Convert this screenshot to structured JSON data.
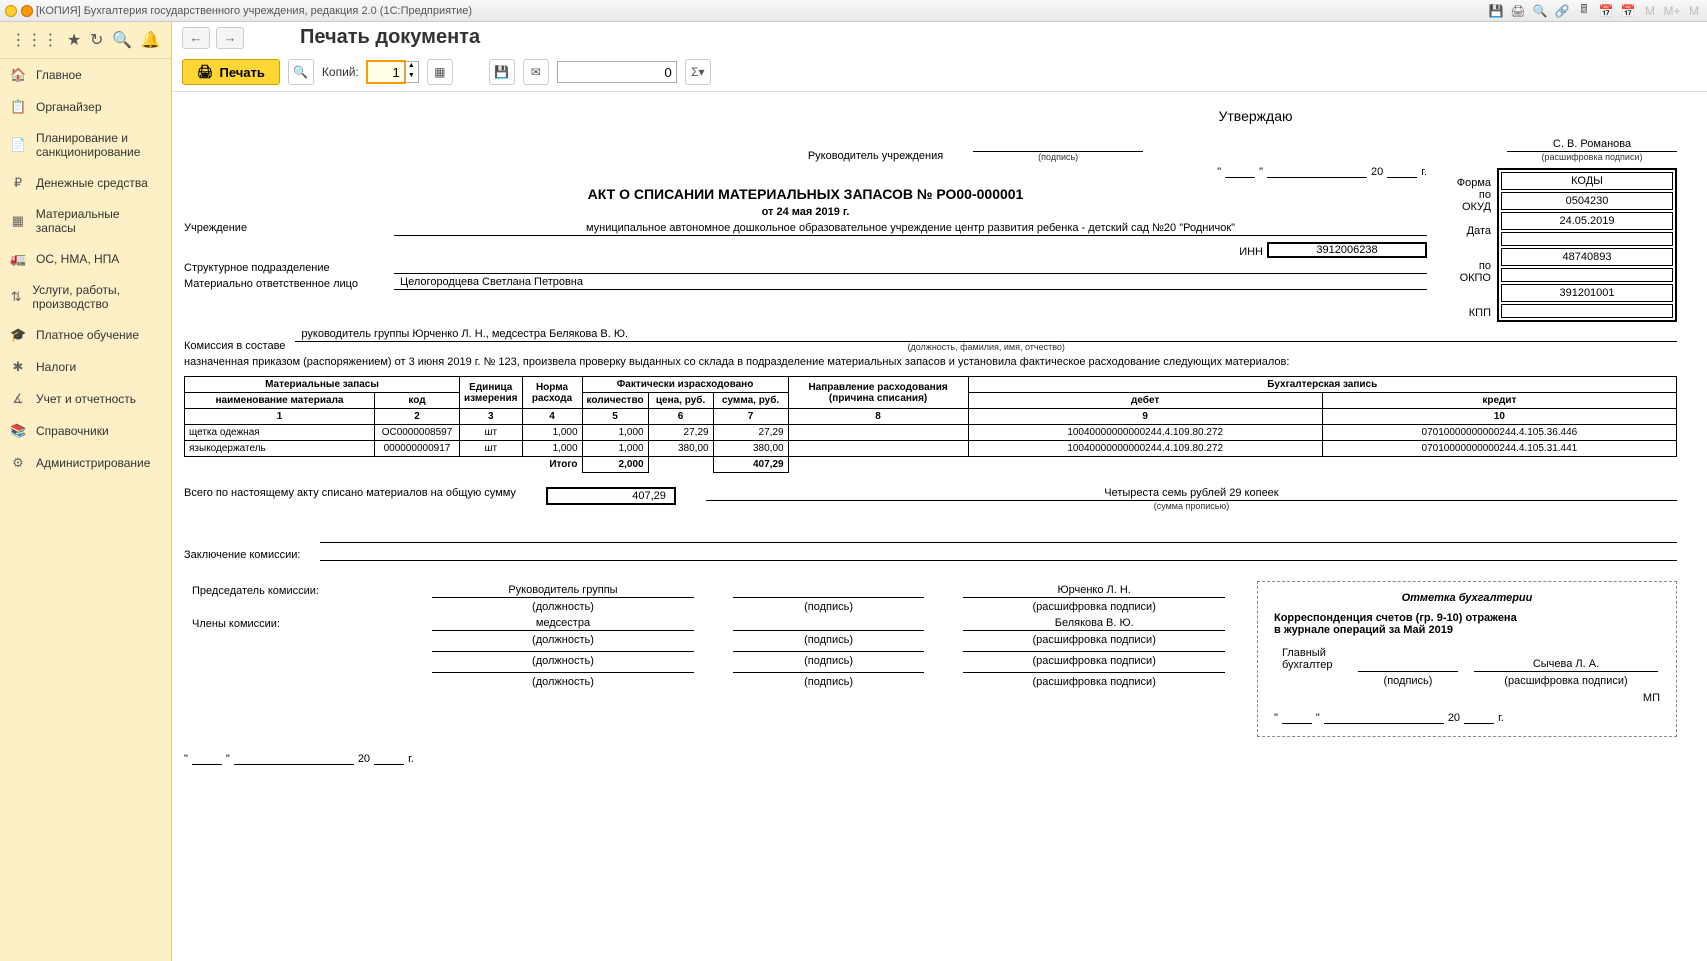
{
  "title": "[КОПИЯ] Бухгалтерия государственного учреждения, редакция 2.0  (1С:Предприятие)",
  "sidebar": {
    "items": [
      {
        "ico": "🏠",
        "label": "Главное"
      },
      {
        "ico": "📋",
        "label": "Органайзер"
      },
      {
        "ico": "📄",
        "label": "Планирование и санкционирование"
      },
      {
        "ico": "₽",
        "label": "Денежные средства"
      },
      {
        "ico": "▦",
        "label": "Материальные запасы"
      },
      {
        "ico": "🚛",
        "label": "ОС, НМА, НПА"
      },
      {
        "ico": "⇅",
        "label": "Услуги, работы, производство"
      },
      {
        "ico": "🎓",
        "label": "Платное обучение"
      },
      {
        "ico": "✱",
        "label": "Налоги"
      },
      {
        "ico": "∡",
        "label": "Учет и отчетность"
      },
      {
        "ico": "📚",
        "label": "Справочники"
      },
      {
        "ico": "⚙",
        "label": "Администрирование"
      }
    ]
  },
  "page": {
    "title": "Печать документа",
    "printBtn": "Печать",
    "copiesLbl": "Копий:",
    "copies": "1",
    "num": "0",
    "sigma": "Σ"
  },
  "doc": {
    "approve": "Утверждаю",
    "headLbl": "Руководитель учреждения",
    "headName": "С. В. Романова",
    "signSub": "(подпись)",
    "decodeSub": "(расшифровка подписи)",
    "dateTpl20": "20",
    "yearG": "г.",
    "actTitle": "АКТ О СПИСАНИИ МАТЕРИАЛЬНЫХ ЗАПАСОВ  № РО00-000001",
    "actDate": "от 24 мая 2019 г.",
    "orgLbl": "Учреждение",
    "orgName": "муниципальное автономное дошкольное образовательное учреждение центр развития ребенка - детский сад №20 \"Родничок\"",
    "formLbl": "Форма  по ОКУД",
    "dateLbl": "Дата",
    "okpoLbl": "по ОКПО",
    "innLbl": "ИНН",
    "kppLbl": "КПП",
    "codesHdr": "КОДЫ",
    "okud": "0504230",
    "date": "24.05.2019",
    "okpo": "48740893",
    "inn": "3912006238",
    "kpp": "391201001",
    "structLbl": "Структурное подразделение",
    "molLbl": "Материально ответственное лицо",
    "molName": "Целогородцева Светлана Петровна",
    "commLbl": "Комиссия в составе",
    "commNames": "руководитель группы Юрченко Л. Н., медсестра Белякова  В. Ю.",
    "commSub": "(должность, фамилия, имя, отчество)",
    "orderText": "назначенная приказом (распоряжением)  от  3 июня 2019 г. №  123, произвела проверку выданных со склада в подразделение материальных запасов и установила фактическое расходование следующих материалов:",
    "tbl": {
      "h": {
        "mat": "Материальные запасы",
        "name": "наименование материала",
        "code": "код",
        "unit": "Единица измерения",
        "norm": "Норма расхода",
        "fact": "Фактически израсходовано",
        "qty": "количество",
        "price": "цена, руб.",
        "sum": "сумма, руб.",
        "dir": "Направление расходования (причина списания)",
        "acc": "Бухгалтерская запись",
        "debit": "дебет",
        "credit": "кредит"
      },
      "rows": [
        {
          "name": "щетка одежная",
          "code": "ОС0000008597",
          "unit": "шт",
          "norm": "1,000",
          "qty": "1,000",
          "price": "27,29",
          "sum": "27,29",
          "debit": "10040000000000244.4.109.80.272",
          "credit": "07010000000000244.4.105.36.446"
        },
        {
          "name": "языкодержатель",
          "code": "000000000917",
          "unit": "шт",
          "norm": "1,000",
          "qty": "1,000",
          "price": "380,00",
          "sum": "380,00",
          "debit": "10040000000000244.4.109.80.272",
          "credit": "07010000000000244.4.105.31.441"
        }
      ],
      "total": "Итого",
      "totQty": "2,000",
      "totSum": "407,29"
    },
    "totalLbl": "Всего по настоящему акту списано материалов на общую сумму",
    "totalNum": "407,29",
    "totalWords": "Четыреста семь рублей 29 копеек",
    "totalWordsSub": "(сумма прописью)",
    "conclLbl": "Заключение комиссии:",
    "chairLbl": "Председатель комиссии:",
    "chairPos": "Руководитель группы",
    "chairName": "Юрченко Л. Н.",
    "memLbl": "Члены комиссии:",
    "memPos": "медсестра",
    "memName": "Белякова  В. Ю.",
    "posSub": "(должность)",
    "bh": {
      "title": "Отметка бухгалтерии",
      "l1": "Корреспонденция счетов (гр. 9-10) отражена",
      "l2": "в журнале операций за Май 2019",
      "chiefLbl": "Главный бухгалтер",
      "chiefName": "Сычева Л. А.",
      "mp": "МП"
    }
  }
}
